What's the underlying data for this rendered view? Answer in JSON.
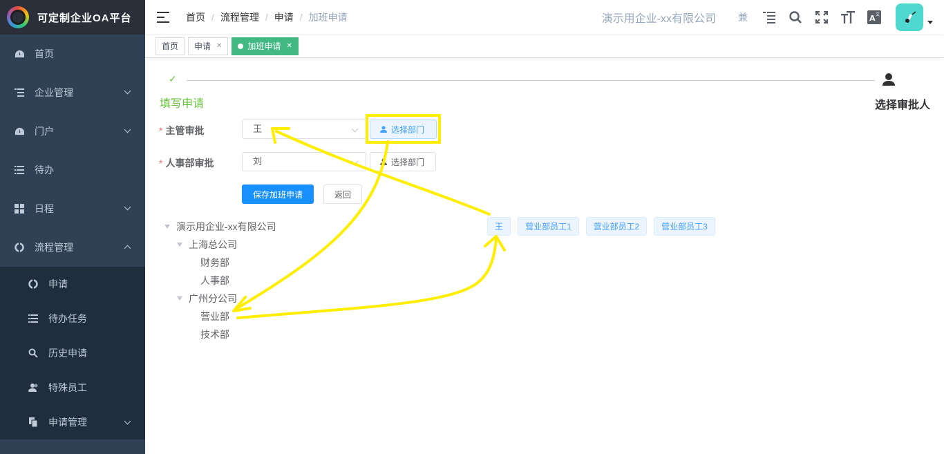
{
  "app": {
    "title": "可定制企业OA平台"
  },
  "sidebar": {
    "items": [
      {
        "label": "首页",
        "icon": "dashboard-icon",
        "has_arrow": false
      },
      {
        "label": "企业管理",
        "icon": "list-tree-icon",
        "has_arrow": true
      },
      {
        "label": "门户",
        "icon": "dashboard-icon",
        "has_arrow": true
      },
      {
        "label": "待办",
        "icon": "list-icon",
        "has_arrow": false
      },
      {
        "label": "日程",
        "icon": "grid-icon",
        "has_arrow": true
      },
      {
        "label": "流程管理",
        "icon": "process-icon",
        "has_arrow": true,
        "expanded": true
      }
    ],
    "sub_items": [
      {
        "label": "申请",
        "icon": "process-icon"
      },
      {
        "label": "待办任务",
        "icon": "list-icon"
      },
      {
        "label": "历史申请",
        "icon": "search-icon"
      },
      {
        "label": "特殊员工",
        "icon": "users-icon"
      },
      {
        "label": "申请管理",
        "icon": "copy-icon",
        "has_arrow": true
      }
    ]
  },
  "navbar": {
    "breadcrumb": [
      "首页",
      "流程管理",
      "申请",
      "加班申请"
    ],
    "company": "演示用企业-xx有限公司",
    "role": "兼"
  },
  "tags": [
    {
      "label": "首页",
      "closable": false,
      "active": false
    },
    {
      "label": "申请",
      "closable": true,
      "active": false
    },
    {
      "label": "加班申请",
      "closable": true,
      "active": true
    }
  ],
  "steps": [
    {
      "title": "填写申请",
      "status": "done"
    },
    {
      "title": "选择审批人",
      "status": "current"
    }
  ],
  "form": {
    "manager": {
      "label": "主管审批",
      "value": "王",
      "button": "选择部门"
    },
    "hr": {
      "label": "人事部审批",
      "value": "刘",
      "button": "选择部门"
    },
    "save_label": "保存加班申请",
    "back_label": "返回"
  },
  "tree": {
    "root": "演示用企业-xx有限公司",
    "nodes": [
      {
        "label": "上海总公司",
        "children": [
          "财务部",
          "人事部"
        ]
      },
      {
        "label": "广州分公司",
        "children": [
          "营业部",
          "技术部"
        ]
      }
    ]
  },
  "employees": [
    "王",
    "营业部员工1",
    "营业部员工2",
    "营业部员工3"
  ],
  "colors": {
    "sidebar_bg": "#304156",
    "accent_green": "#42b983",
    "primary_blue": "#1890ff",
    "annotation": "#ffee00"
  }
}
